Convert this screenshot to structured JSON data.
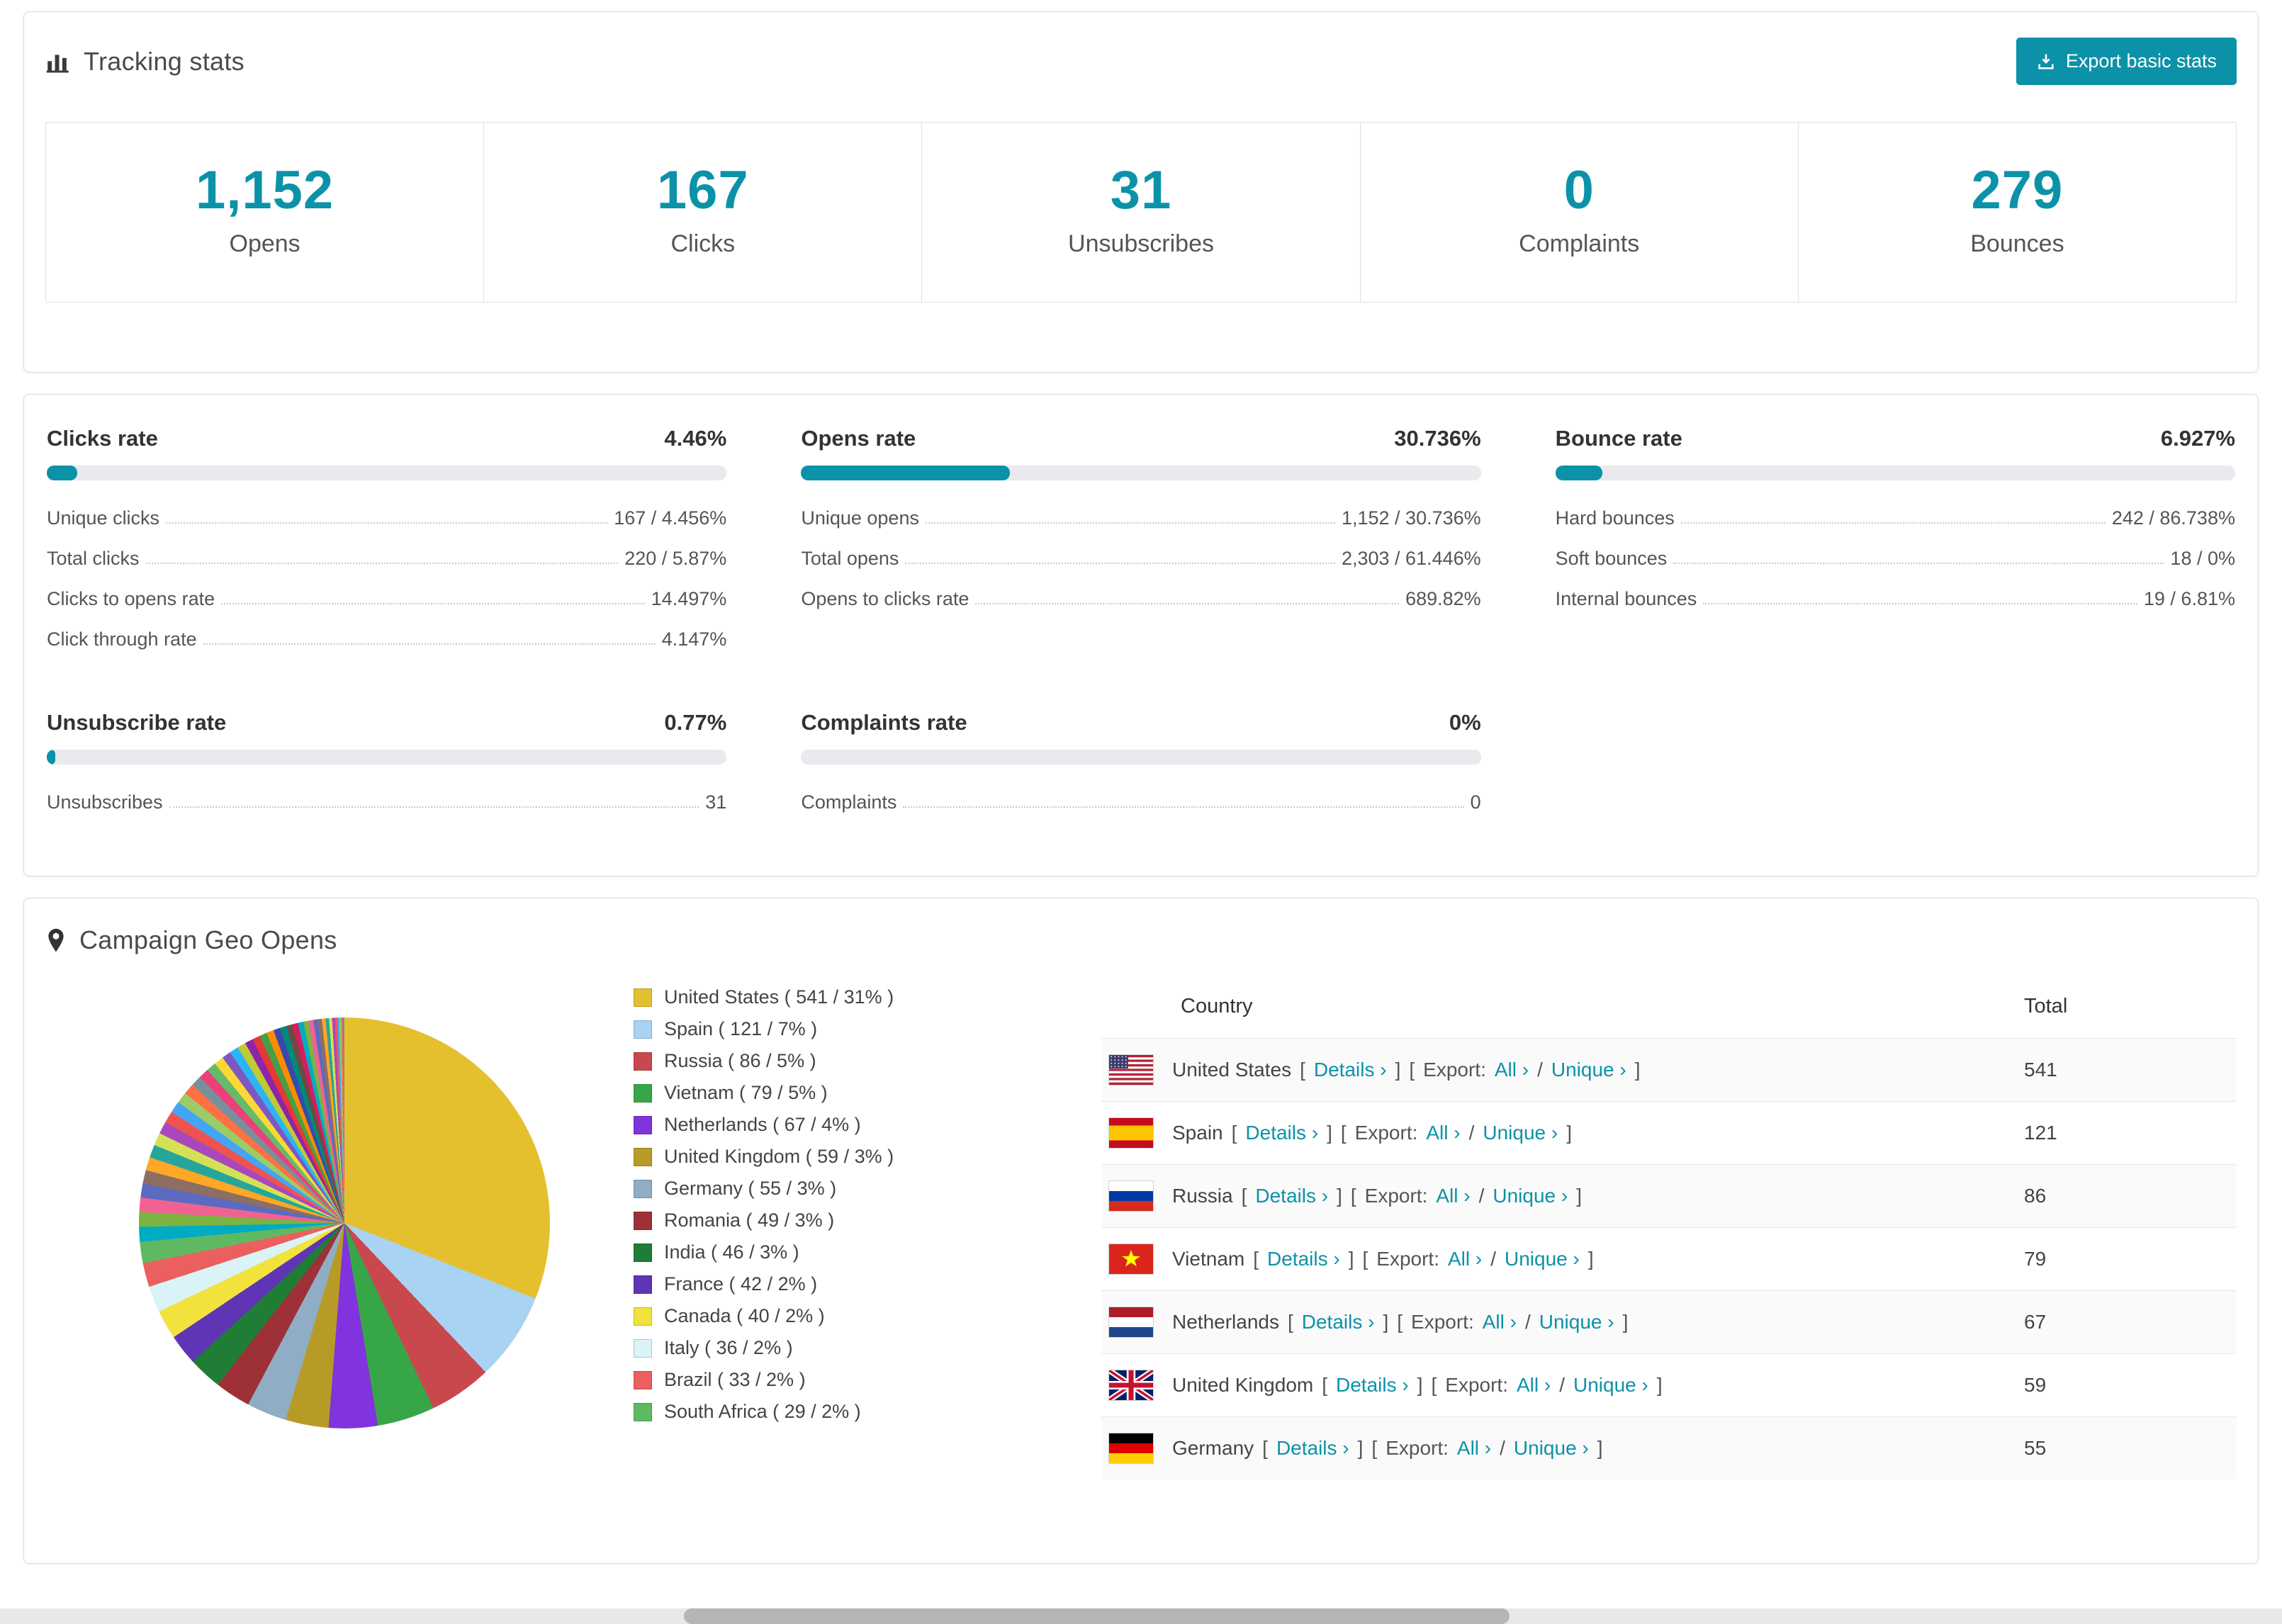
{
  "colors": {
    "accent": "#0C92A8"
  },
  "tracking": {
    "title": "Tracking stats",
    "export_button": "Export basic stats",
    "stats": [
      {
        "value": "1,152",
        "label": "Opens"
      },
      {
        "value": "167",
        "label": "Clicks"
      },
      {
        "value": "31",
        "label": "Unsubscribes"
      },
      {
        "value": "0",
        "label": "Complaints"
      },
      {
        "value": "279",
        "label": "Bounces"
      }
    ]
  },
  "rates": [
    {
      "id": "clicks",
      "title": "Clicks rate",
      "value": "4.46%",
      "percent": 4.46,
      "rows": [
        [
          "Unique clicks",
          "167 / 4.456%"
        ],
        [
          "Total clicks",
          "220 / 5.87%"
        ],
        [
          "Clicks to opens rate",
          "14.497%"
        ],
        [
          "Click through rate",
          "4.147%"
        ]
      ]
    },
    {
      "id": "opens",
      "title": "Opens rate",
      "value": "30.736%",
      "percent": 30.736,
      "rows": [
        [
          "Unique opens",
          "1,152 / 30.736%"
        ],
        [
          "Total opens",
          "2,303 / 61.446%"
        ],
        [
          "Opens to clicks rate",
          "689.82%"
        ]
      ]
    },
    {
      "id": "bounce",
      "title": "Bounce rate",
      "value": "6.927%",
      "percent": 6.927,
      "rows": [
        [
          "Hard bounces",
          "242 / 86.738%"
        ],
        [
          "Soft bounces",
          "18 / 0%"
        ],
        [
          "Internal bounces",
          "19 / 6.81%"
        ]
      ]
    },
    {
      "id": "unsubscribe",
      "title": "Unsubscribe rate",
      "value": "0.77%",
      "percent": 0.77,
      "rows": [
        [
          "Unsubscribes",
          "31"
        ]
      ]
    },
    {
      "id": "complaints",
      "title": "Complaints rate",
      "value": "0%",
      "percent": 0,
      "rows": [
        [
          "Complaints",
          "0"
        ]
      ]
    }
  ],
  "geo": {
    "title": "Campaign Geo Opens",
    "table": {
      "columns": [
        "Country",
        "Total"
      ],
      "link_labels": {
        "details": "Details",
        "export": "Export:",
        "all": "All",
        "unique": "Unique"
      },
      "rows": [
        {
          "country": "United States",
          "flag": "us",
          "total": "541"
        },
        {
          "country": "Spain",
          "flag": "es",
          "total": "121"
        },
        {
          "country": "Russia",
          "flag": "ru",
          "total": "86"
        },
        {
          "country": "Vietnam",
          "flag": "vn",
          "total": "79"
        },
        {
          "country": "Netherlands",
          "flag": "nl",
          "total": "67"
        },
        {
          "country": "United Kingdom",
          "flag": "gb",
          "total": "59"
        },
        {
          "country": "Germany",
          "flag": "de",
          "total": "55"
        }
      ]
    }
  },
  "chart_data": {
    "type": "pie",
    "title": "Campaign Geo Opens",
    "legend_position": "right",
    "label_format": "{name} ( {value} / {percent}% )",
    "series": [
      {
        "name": "United States",
        "value": 541,
        "percent": 31,
        "color": "#E4C02F"
      },
      {
        "name": "Spain",
        "value": 121,
        "percent": 7,
        "color": "#A9D3F2"
      },
      {
        "name": "Russia",
        "value": 86,
        "percent": 5,
        "color": "#C9484D"
      },
      {
        "name": "Vietnam",
        "value": 79,
        "percent": 5,
        "color": "#37A648"
      },
      {
        "name": "Netherlands",
        "value": 67,
        "percent": 4,
        "color": "#8133DD"
      },
      {
        "name": "United Kingdom",
        "value": 59,
        "percent": 3,
        "color": "#B89B26"
      },
      {
        "name": "Germany",
        "value": 55,
        "percent": 3,
        "color": "#8FADC4"
      },
      {
        "name": "Romania",
        "value": 49,
        "percent": 3,
        "color": "#9E3137"
      },
      {
        "name": "India",
        "value": 46,
        "percent": 3,
        "color": "#207D36"
      },
      {
        "name": "France",
        "value": 42,
        "percent": 2,
        "color": "#5F35B5"
      },
      {
        "name": "Canada",
        "value": 40,
        "percent": 2,
        "color": "#F2E23E"
      },
      {
        "name": "Italy",
        "value": 36,
        "percent": 2,
        "color": "#D9F3F6"
      },
      {
        "name": "Brazil",
        "value": 33,
        "percent": 2,
        "color": "#EC5F5F"
      },
      {
        "name": "South Africa",
        "value": 29,
        "percent": 2,
        "color": "#5FB963"
      }
    ],
    "others": {
      "value": 462,
      "slice_count": 44,
      "palette": [
        "#00ACC1",
        "#7CB342",
        "#F06292",
        "#5C6BC0",
        "#8D6E63",
        "#FFA726",
        "#26A69A",
        "#D4E157",
        "#AB47BC",
        "#EF5350",
        "#42A5F5",
        "#9CCC65",
        "#FF7043",
        "#78909C",
        "#EC407A",
        "#66BB6A",
        "#FDD835",
        "#7E57C2",
        "#29B6F6",
        "#C0CA33",
        "#8E24AA",
        "#E53935",
        "#43A047",
        "#FB8C00",
        "#3949AB",
        "#00897B",
        "#6D4C41",
        "#D81B60"
      ]
    }
  }
}
